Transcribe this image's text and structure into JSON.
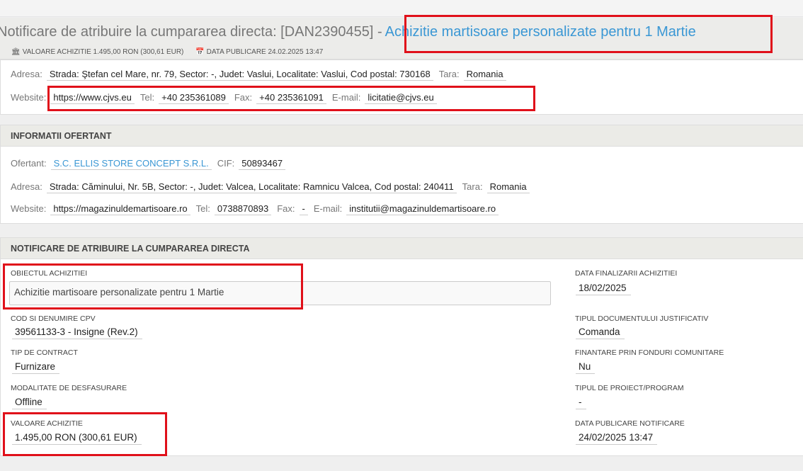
{
  "header": {
    "title_prefix": "Notificare de atribuire la cumpararea directa: [DAN2390455] -",
    "title_link": "Achizitie martisoare personalizate pentru 1 Martie",
    "meta_value": "VALOARE ACHIZITIE 1.495,00 RON (300,61 EUR)",
    "meta_date": "DATA PUBLICARE 24.02.2025 13:47"
  },
  "authority": {
    "address_label": "Adresa:",
    "address": "Strada: Ştefan cel Mare, nr. 79, Sector: -, Judet: Vaslui, Localitate: Vaslui, Cod postal: 730168",
    "country_label": "Tara:",
    "country": "Romania",
    "website_label": "Website:",
    "website": "https://www.cjvs.eu",
    "tel_label": "Tel:",
    "tel": "+40 235361089",
    "fax_label": "Fax:",
    "fax": "+40 235361091",
    "email_label": "E-mail:",
    "email": "licitatie@cjvs.eu"
  },
  "bidder": {
    "heading": "INFORMATII OFERTANT",
    "name_label": "Ofertant:",
    "name": "S.C. ELLIS STORE CONCEPT S.R.L.",
    "cif_label": "CIF:",
    "cif": "50893467",
    "address_label": "Adresa:",
    "address": "Strada: Căminului, Nr. 5B, Sector: -, Judet: Valcea, Localitate: Ramnicu Valcea, Cod postal: 240411",
    "country_label": "Tara:",
    "country": "Romania",
    "website_label": "Website:",
    "website": "https://magazinuldemartisoare.ro",
    "tel_label": "Tel:",
    "tel": "0738870893",
    "fax_label": "Fax:",
    "fax": "-",
    "email_label": "E-mail:",
    "email": "institutii@magazinuldemartisoare.ro"
  },
  "notice": {
    "heading": "NOTIFICARE DE ATRIBUIRE LA CUMPARAREA DIRECTA",
    "object_label": "OBIECTUL ACHIZITIEI",
    "object": "Achizitie martisoare personalizate pentru 1 Martie",
    "cpv_label": "COD SI DENUMIRE CPV",
    "cpv": "39561133-3 - Insigne (Rev.2)",
    "contract_label": "TIP DE CONTRACT",
    "contract": "Furnizare",
    "mode_label": "MODALITATE DE DESFASURARE",
    "mode": "Offline",
    "value_label": "VALOARE ACHIZITIE",
    "value": "1.495,00 RON (300,61 EUR)",
    "final_date_label": "DATA FINALIZARII ACHIZITIEI",
    "final_date": "18/02/2025",
    "doc_type_label": "TIPUL DOCUMENTULUI JUSTIFICATIV",
    "doc_type": "Comanda",
    "eu_funds_label": "FINANTARE PRIN FONDURI COMUNITARE",
    "eu_funds": "Nu",
    "project_label": "TIPUL DE PROIECT/PROGRAM",
    "project": "-",
    "publish_label": "DATA PUBLICARE NOTIFICARE",
    "publish": "24/02/2025 13:47"
  },
  "colors": {
    "link": "#3a97d4",
    "highlight": "#e0101a",
    "panel_head": "#ebebe7"
  },
  "icons": [
    "bank-icon",
    "calendar-icon"
  ]
}
